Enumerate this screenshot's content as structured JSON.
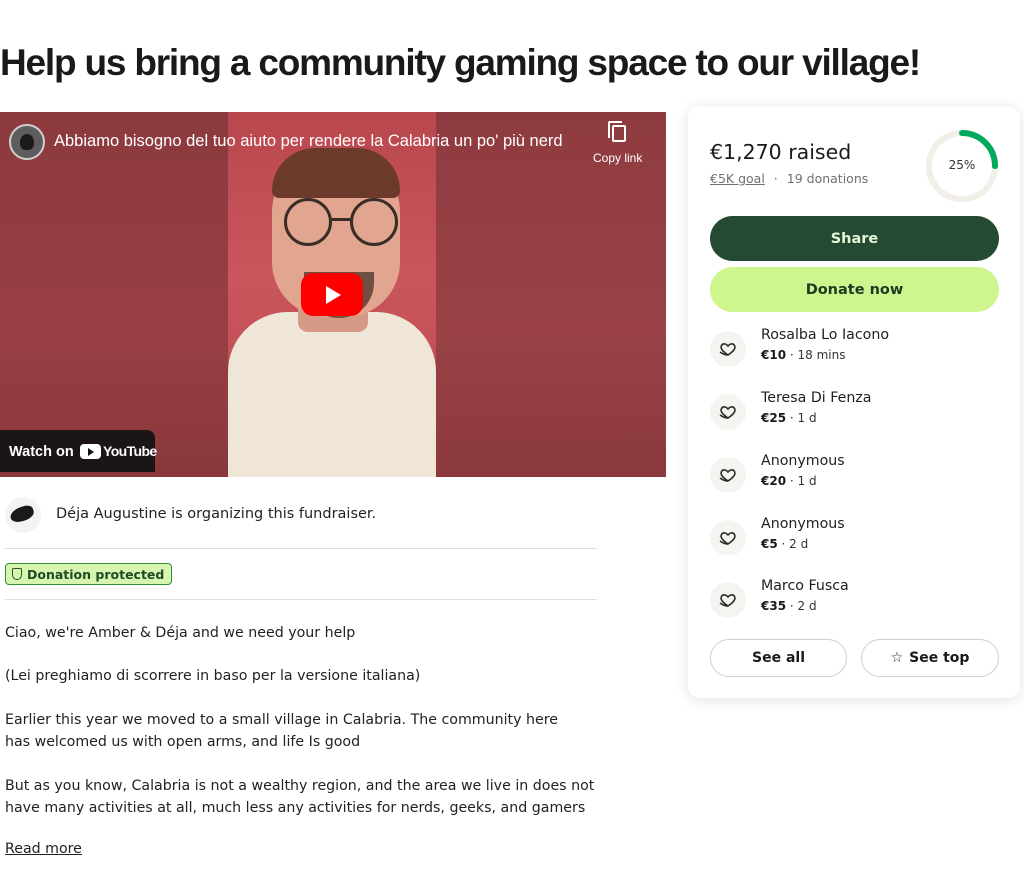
{
  "page": {
    "title": "Help us bring a community gaming space to our village!"
  },
  "video": {
    "title": "Abbiamo bisogno del tuo aiuto per rendere la Calabria un po' più nerd",
    "copy_link_label": "Copy link",
    "watch_on_label": "Watch on",
    "platform_label": "YouTube"
  },
  "organizer": {
    "text": "Déja Augustine is organizing this fundraiser."
  },
  "badge": {
    "label": "Donation protected"
  },
  "story": {
    "paragraphs": [
      "Ciao, we're Amber & Déja and we need your help",
      "(Lei preghiamo di scorrere in baso per la versione italiana)",
      "Earlier this year we moved to a small village in Calabria. The community here has welcomed us with open arms, and life Is good",
      "But as you know, Calabria is not a wealthy region, and the area we live in does not have many activities at all, much less any activities for nerds, geeks, and gamers"
    ],
    "read_more": "Read more"
  },
  "donation_card": {
    "raised": "€1,270 raised",
    "goal": "€5K goal",
    "separator": "·",
    "donations": "19 donations",
    "progress_percent": 25,
    "progress_label": "25%",
    "share_label": "Share",
    "donate_label": "Donate now",
    "donors": [
      {
        "name": "Rosalba Lo Iacono",
        "amount": "€10",
        "time": " · 18 mins"
      },
      {
        "name": "Teresa Di Fenza",
        "amount": "€25",
        "time": " · 1 d"
      },
      {
        "name": "Anonymous",
        "amount": "€20",
        "time": " · 1 d"
      },
      {
        "name": "Anonymous",
        "amount": "€5",
        "time": " · 2 d"
      },
      {
        "name": "Marco Fusca",
        "amount": "€35",
        "time": " · 2 d"
      }
    ],
    "see_all_label": "See all",
    "see_top_label": "See top"
  },
  "colors": {
    "share_bg": "#254a33",
    "donate_bg": "#cff58f",
    "progress": "#02a95c",
    "badge_bg": "#d8f5b0"
  }
}
